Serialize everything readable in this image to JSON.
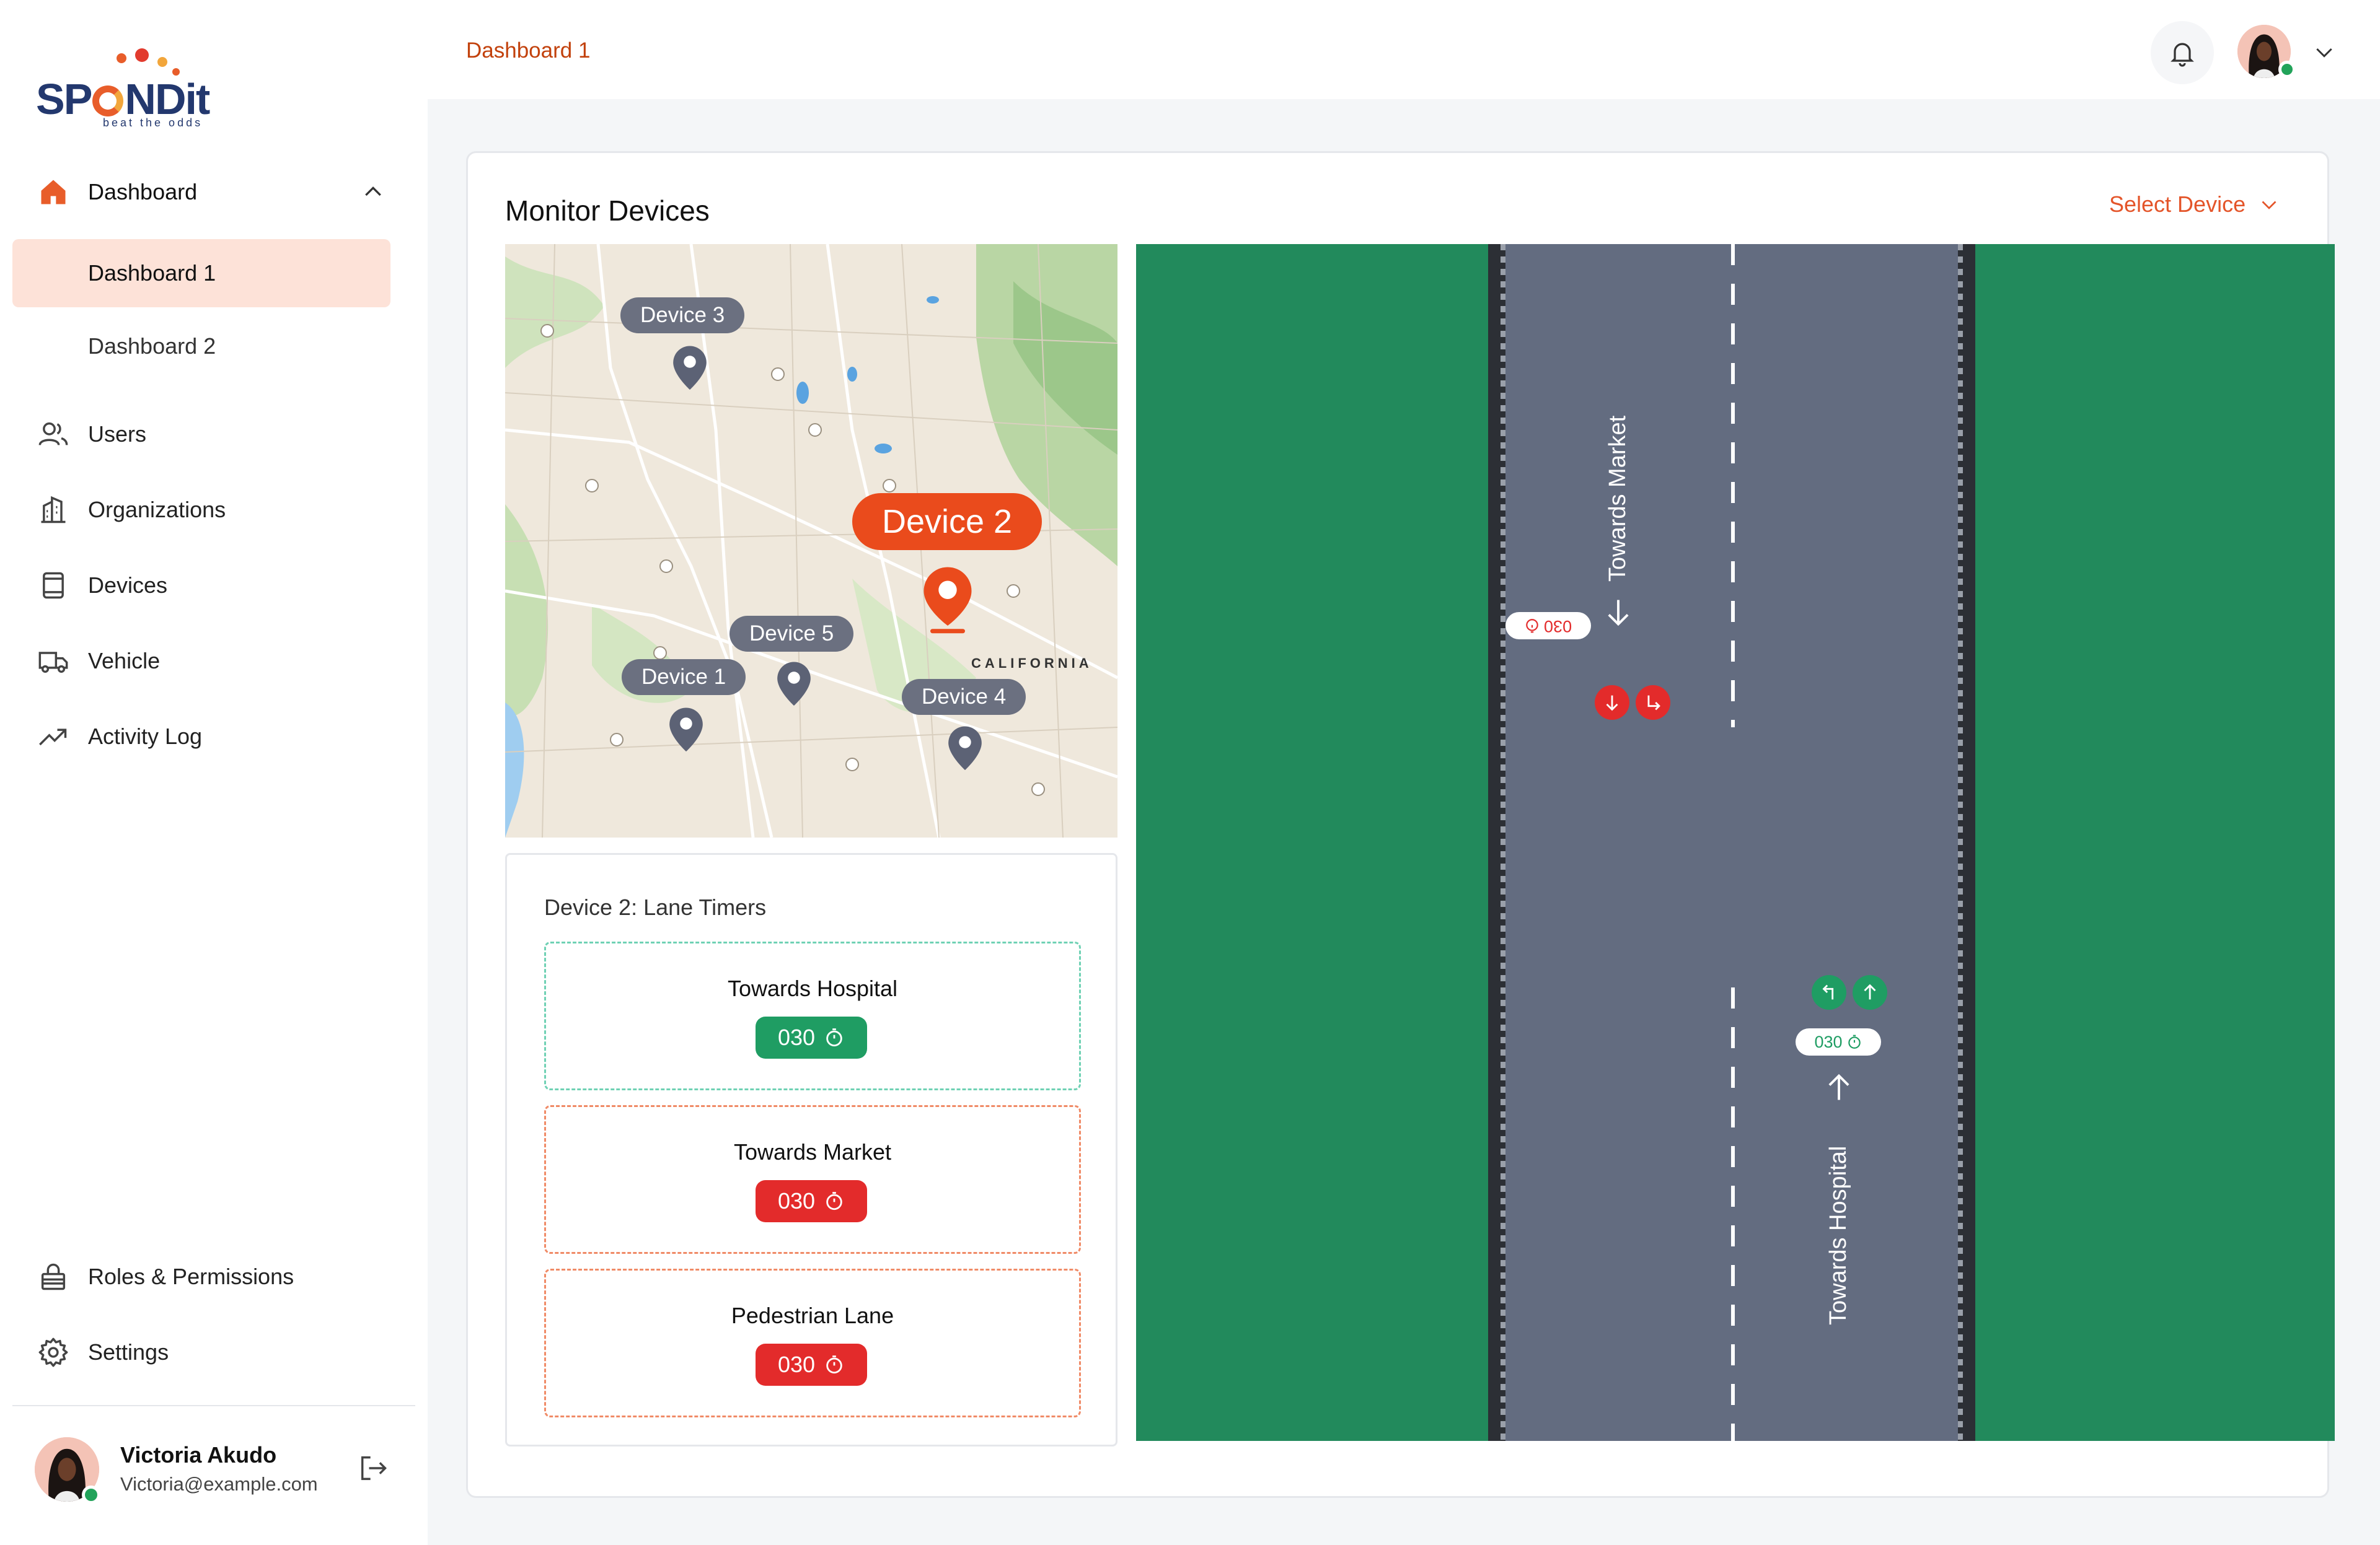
{
  "brand": {
    "name": "SPONDit",
    "tagline": "beat the odds"
  },
  "sidebar": {
    "dashboard_label": "Dashboard",
    "sub_items": [
      "Dashboard 1",
      "Dashboard 2"
    ],
    "items": [
      {
        "label": "Users",
        "icon": "users-icon"
      },
      {
        "label": "Organizations",
        "icon": "building-icon"
      },
      {
        "label": "Devices",
        "icon": "device-icon"
      },
      {
        "label": "Vehicle",
        "icon": "truck-icon"
      },
      {
        "label": "Activity Log",
        "icon": "trend-icon"
      }
    ],
    "bottom_items": [
      {
        "label": "Roles & Permissions",
        "icon": "lock-icon"
      },
      {
        "label": "Settings",
        "icon": "gear-icon"
      }
    ]
  },
  "user": {
    "name": "Victoria Akudo",
    "email": "Victoria@example.com"
  },
  "topbar": {
    "breadcrumb": "Dashboard 1"
  },
  "main": {
    "title": "Monitor Devices",
    "select_device": "Select Device",
    "map": {
      "region_label": "CALIFORNIA",
      "devices": [
        "Device 3",
        "Device 2",
        "Device 5",
        "Device 1",
        "Device 4"
      ],
      "selected": "Device 2"
    },
    "timers": {
      "title": "Device 2: Lane Timers",
      "lanes": [
        {
          "name": "Towards Hospital",
          "value": "030",
          "status": "green"
        },
        {
          "name": "Towards Market",
          "value": "030",
          "status": "red"
        },
        {
          "name": "Pedestrian Lane",
          "value": "030",
          "status": "red"
        }
      ]
    },
    "road": {
      "left_lane_label": "Towards Market",
      "right_lane_label": "Towards Hospital",
      "left_timer": "030",
      "right_timer": "030"
    }
  },
  "colors": {
    "accent": "#e4552a",
    "active_bg": "#fde2d8",
    "green": "#1f9d63",
    "red": "#e32b2b",
    "road": "#636c80",
    "grass": "#228a5c"
  }
}
